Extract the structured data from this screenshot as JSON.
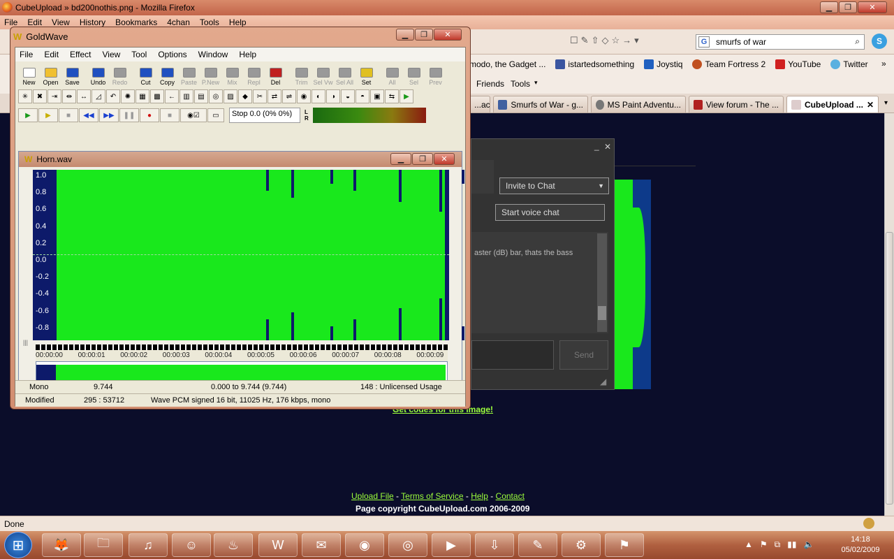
{
  "firefox": {
    "title": "CubeUpload » bd200nothis.png - Mozilla Firefox",
    "menu": [
      "File",
      "Edit",
      "View",
      "History",
      "Bookmarks",
      "4chan",
      "Tools",
      "Help"
    ],
    "search_value": "smurfs of war",
    "bookmarks": [
      "modo, the Gadget ...",
      "istartedsomething",
      "Joystiq",
      "Team Fortress 2",
      "YouTube",
      "Twitter"
    ],
    "bookmarks2": [
      "Friends",
      "Tools"
    ],
    "tabs": [
      "...ac...",
      "Smurfs of War - g...",
      "MS Paint Adventu...",
      "View forum - The ...",
      "CubeUpload ..."
    ],
    "status": "Done"
  },
  "page": {
    "chat_invite": "Invite to Chat",
    "chat_voice": "Start voice chat",
    "chat_text": "aster (dB) bar, thats the bass",
    "chat_send": "Send",
    "get_codes": "Get codes for this image!",
    "footer_links": [
      "Upload File",
      "Terms of Service",
      "Help",
      "Contact"
    ],
    "footer_sep": " - ",
    "copyright": "Page copyright CubeUpload.com 2006-2009"
  },
  "goldwave": {
    "title": "GoldWave",
    "menu": [
      "File",
      "Edit",
      "Effect",
      "View",
      "Tool",
      "Options",
      "Window",
      "Help"
    ],
    "toolbar": [
      {
        "label": "New",
        "enabled": true
      },
      {
        "label": "Open",
        "enabled": true
      },
      {
        "label": "Save",
        "enabled": true
      },
      {
        "label": "Undo",
        "enabled": true
      },
      {
        "label": "Redo",
        "enabled": false
      },
      {
        "label": "Cut",
        "enabled": true
      },
      {
        "label": "Copy",
        "enabled": true
      },
      {
        "label": "Paste",
        "enabled": false
      },
      {
        "label": "P.New",
        "enabled": false
      },
      {
        "label": "Mix",
        "enabled": false
      },
      {
        "label": "Repl",
        "enabled": false
      },
      {
        "label": "Del",
        "enabled": true
      },
      {
        "label": "Trim",
        "enabled": false
      },
      {
        "label": "Sel Vw",
        "enabled": false
      },
      {
        "label": "Sel All",
        "enabled": false
      },
      {
        "label": "Set",
        "enabled": true
      },
      {
        "label": "All",
        "enabled": false
      },
      {
        "label": "Sel",
        "enabled": false
      },
      {
        "label": "Prev",
        "enabled": false
      }
    ],
    "transport_status": "Stop 0.0 (0% 0%)",
    "meter_label": "L R",
    "document": {
      "title": "Horn.wav",
      "y_labels": [
        "1.0",
        "0.8",
        "0.6",
        "0.4",
        "0.2",
        "0.0",
        "-0.2",
        "-0.4",
        "-0.6",
        "-0.8"
      ],
      "time_labels": [
        "00:00:00",
        "00:00:01",
        "00:00:02",
        "00:00:03",
        "00:00:04",
        "00:00:05",
        "00:00:06",
        "00:00:07",
        "00:00:08",
        "00:00:09"
      ]
    },
    "status": {
      "channels": "Mono",
      "length": "9.744",
      "selection": "0.000 to 9.744 (9.744)",
      "usage": "148 : Unlicensed Usage",
      "state": "Modified",
      "position": "295 : 53712",
      "format": "Wave PCM signed 16 bit, 11025 Hz, 176 kbps, mono"
    }
  },
  "taskbar": {
    "time": "14:18",
    "date": "05/02/2009"
  }
}
